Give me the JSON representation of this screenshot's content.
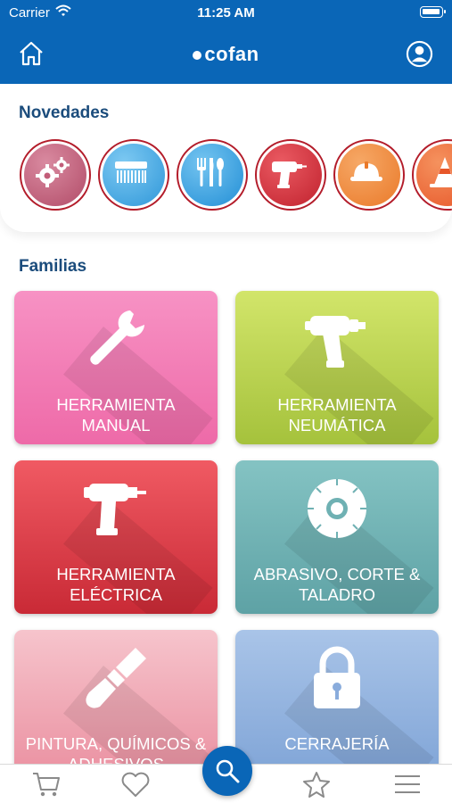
{
  "status_bar": {
    "carrier": "Carrier",
    "time": "11:25 AM"
  },
  "header": {
    "logo": "cofan",
    "home_icon": "home-icon",
    "user_icon": "user-icon"
  },
  "novedades": {
    "title": "Novedades",
    "items": [
      {
        "icon": "gears-icon",
        "color": "#c9607a"
      },
      {
        "icon": "brush-icon",
        "color": "#4aaee6"
      },
      {
        "icon": "cutlery-icon",
        "color": "#3aa6e2"
      },
      {
        "icon": "drill-icon",
        "color": "#d6313b"
      },
      {
        "icon": "helmet-icon",
        "color": "#ee8a3a"
      },
      {
        "icon": "cone-icon",
        "color": "#ef6a3a"
      }
    ]
  },
  "familias": {
    "title": "Familias",
    "cards": [
      {
        "label_line1": "HERRAMIENTA",
        "label_line2": "MANUAL",
        "icon": "wrench-icon",
        "color_top": "#f792c4",
        "color_bottom": "#ee6aa8"
      },
      {
        "label_line1": "HERRAMIENTA",
        "label_line2": "NEUMÁTICA",
        "icon": "pneumatic-gun-icon",
        "color_top": "#d2e56a",
        "color_bottom": "#a5c23c"
      },
      {
        "label_line1": "HERRAMIENTA",
        "label_line2": "ELÉCTRICA",
        "icon": "drill-icon",
        "color_top": "#f05a63",
        "color_bottom": "#c92a36"
      },
      {
        "label_line1": "ABRASIVO, CORTE &",
        "label_line2": "TALADRO",
        "icon": "saw-blade-icon",
        "color_top": "#84c3c3",
        "color_bottom": "#5ea2a5"
      },
      {
        "label_line1": "PINTURA, QUÍMICOS &",
        "label_line2": "ADHESIVOS",
        "icon": "paint-brush-icon",
        "color_top": "#f6c4cc",
        "color_bottom": "#ea8e9f"
      },
      {
        "label_line1": "CERRAJERÍA",
        "label_line2": "",
        "icon": "padlock-icon",
        "color_top": "#a9c4e8",
        "color_bottom": "#7ea3d6"
      }
    ]
  },
  "tabbar": {
    "items": [
      "cart-icon",
      "heart-icon",
      "search-icon",
      "star-icon",
      "menu-icon"
    ]
  }
}
